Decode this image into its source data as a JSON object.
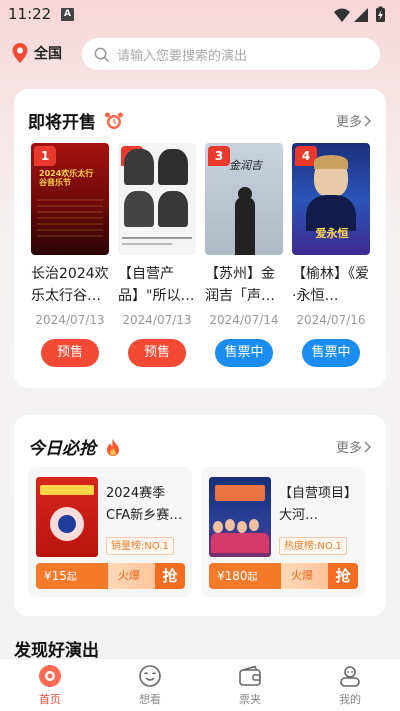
{
  "status_bar": {
    "time": "11:22",
    "notif_icon": "A"
  },
  "header": {
    "location": "全国",
    "search_placeholder": "请输入您要搜索的演出"
  },
  "upcoming": {
    "title": "即将开售",
    "more": "更多",
    "items": [
      {
        "rank": "1",
        "title": "长治2024欢乐太行谷…",
        "date": "2024/07/13",
        "status": "预售",
        "status_color": "#f34a35",
        "poster_text": "2024欢乐太行谷音乐节"
      },
      {
        "rank": "2",
        "title": "【自营产品】\"所以…",
        "date": "2024/07/13",
        "status": "预售",
        "status_color": "#f34a35",
        "poster_text": ""
      },
      {
        "rank": "3",
        "title": "【苏州】金润吉「声…",
        "date": "2024/07/14",
        "status": "售票中",
        "status_color": "#1b8df0",
        "poster_text": "金润吉"
      },
      {
        "rank": "4",
        "title": "【榆林】《爱·永恒…",
        "date": "2024/07/16",
        "status": "售票中",
        "status_color": "#1b8df0",
        "poster_text": "爱永恒"
      }
    ]
  },
  "today_deals": {
    "title": "今日必抢",
    "more": "更多",
    "items": [
      {
        "title": "2024赛季CFA新乡赛…",
        "badge": "销量榜:NO.1",
        "price": "¥15",
        "price_suffix": "起",
        "hot": "火爆",
        "action": "抢"
      },
      {
        "title": "【自营项目】大河…",
        "badge": "热度榜:NO.1",
        "price": "¥180",
        "price_suffix": "起",
        "hot": "火爆",
        "action": "抢"
      }
    ]
  },
  "discover": {
    "title": "发现好演出"
  },
  "tabs": [
    {
      "label": "首页",
      "icon": "home-icon",
      "active": true
    },
    {
      "label": "想看",
      "icon": "want-icon",
      "active": false
    },
    {
      "label": "票夹",
      "icon": "ticket-wallet-icon",
      "active": false
    },
    {
      "label": "我的",
      "icon": "profile-icon",
      "active": false
    }
  ],
  "colors": {
    "accent": "#f34a35",
    "blue": "#1b8df0",
    "orange": "#f47a2a"
  }
}
